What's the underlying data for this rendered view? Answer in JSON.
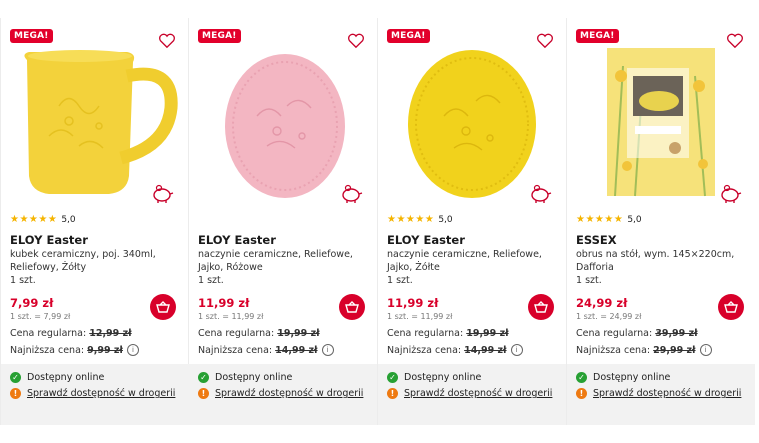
{
  "products": [
    {
      "badge": "MEGA!",
      "rating": "5,0",
      "brand": "ELOY Easter",
      "desc": "kubek ceramiczny, poj. 340ml, Reliefowy, Żółty",
      "qty": "1 szt.",
      "price": "7,99 zł",
      "unit_price": "1 szt. = 7,99 zł",
      "regular_label": "Cena regularna:",
      "regular_price": "12,99 zł",
      "lowest_label": "Najniższa cena:",
      "lowest_price": "9,99 zł",
      "avail_online": "Dostępny online",
      "check_store": "Sprawdź dostępność w drogerii",
      "image": "yellow-mug"
    },
    {
      "badge": "MEGA!",
      "rating": "",
      "brand": "ELOY Easter",
      "desc": "naczynie ceramiczne, Reliefowe, Jajko, Różowe",
      "qty": "1 szt.",
      "price": "11,99 zł",
      "unit_price": "1 szt. = 11,99 zł",
      "regular_label": "Cena regularna:",
      "regular_price": "19,99 zł",
      "lowest_label": "Najniższa cena:",
      "lowest_price": "14,99 zł",
      "avail_online": "Dostępny online",
      "check_store": "Sprawdź dostępność w drogerii",
      "image": "pink-egg-plate"
    },
    {
      "badge": "MEGA!",
      "rating": "5,0",
      "brand": "ELOY Easter",
      "desc": "naczynie ceramiczne, Reliefowe, Jajko, Żółte",
      "qty": "1 szt.",
      "price": "11,99 zł",
      "unit_price": "1 szt. = 11,99 zł",
      "regular_label": "Cena regularna:",
      "regular_price": "19,99 zł",
      "lowest_label": "Najniższa cena:",
      "lowest_price": "14,99 zł",
      "avail_online": "Dostępny online",
      "check_store": "Sprawdź dostępność w drogerii",
      "image": "yellow-egg-plate"
    },
    {
      "badge": "MEGA!",
      "rating": "5,0",
      "brand": "ESSEX",
      "desc": "obrus na stół, wym. 145×220cm, Dafforia",
      "qty": "1 szt.",
      "price": "24,99 zł",
      "unit_price": "1 szt. = 24,99 zł",
      "regular_label": "Cena regularna:",
      "regular_price": "39,99 zł",
      "lowest_label": "Najniższa cena:",
      "lowest_price": "29,99 zł",
      "avail_online": "Dostępny online",
      "check_store": "Sprawdź dostępność w drogerii",
      "image": "tablecloth-package"
    }
  ],
  "colors": {
    "accent": "#d8002a",
    "star": "#f5b400",
    "available": "#27a033",
    "check": "#ee7a12"
  }
}
